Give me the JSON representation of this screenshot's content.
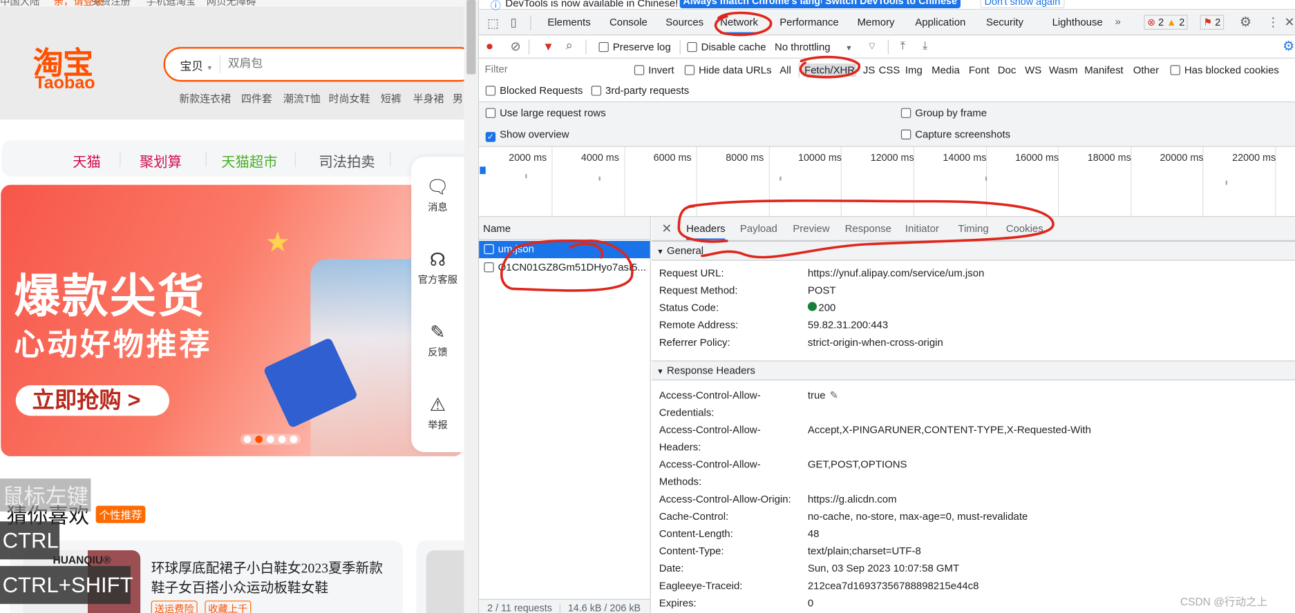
{
  "page": {
    "topbar": [
      "中国大陆",
      "亲，请登录",
      "免费注册",
      "手机逛淘宝",
      "网页无障碍"
    ],
    "logo": {
      "cn": "淘宝",
      "en": "Taobao"
    },
    "search": {
      "scope": "宝贝",
      "placeholder": "双肩包"
    },
    "hot_words": [
      "新款连衣裙",
      "四件套",
      "潮流T恤",
      "时尚女鞋",
      "短裤",
      "半身裙",
      "男"
    ],
    "nav": [
      {
        "label": "天猫",
        "color": "#d0104c"
      },
      {
        "label": "聚划算",
        "color": "#d0104c"
      },
      {
        "label": "天猫超市",
        "color": "#4caf28"
      },
      {
        "label": "司法拍卖",
        "color": "#555555"
      }
    ],
    "banner": {
      "title": "爆款尖货",
      "subtitle": "心动好物推荐",
      "cta": "立即抢购 >",
      "slides": 5,
      "active_slide": 2
    },
    "side": [
      {
        "icon": "message-icon",
        "label": "消息"
      },
      {
        "icon": "headset-icon",
        "label": "官方客服"
      },
      {
        "icon": "edit-icon",
        "label": "反馈"
      },
      {
        "icon": "warning-icon",
        "label": "举报"
      }
    ],
    "guess": {
      "title": "猜你喜欢",
      "badge": "个性推荐"
    },
    "product": {
      "brand": "HUANQIU®",
      "title_line1": "环球厚底配裙子小白鞋女2023夏季新款",
      "title_line2": "鞋子女百搭小众运动板鞋女鞋",
      "tags": [
        "送运费险",
        "收藏上千"
      ]
    },
    "key_overlays": [
      "鼠标左键",
      "CTRL",
      "CTRL+SHIFT"
    ]
  },
  "devtools": {
    "banner": {
      "text": "DevTools is now available in Chinese!",
      "btn1": "Always match Chrome's language",
      "btn2": "Switch DevTools to Chinese",
      "btn3": "Don't show again"
    },
    "tabs": [
      "Elements",
      "Console",
      "Sources",
      "Network",
      "Performance",
      "Memory",
      "Application",
      "Security",
      "Lighthouse"
    ],
    "active_tab": "Network",
    "counts": {
      "errors": "2",
      "warnings": "2",
      "issues": "2"
    },
    "toolbar": {
      "preserve_log": "Preserve log",
      "disable_cache": "Disable cache",
      "throttling": "No throttling"
    },
    "filter": {
      "placeholder": "Filter",
      "invert": "Invert",
      "hide_data_urls": "Hide data URLs",
      "types": [
        "All",
        "Fetch/XHR",
        "JS",
        "CSS",
        "Img",
        "Media",
        "Font",
        "Doc",
        "WS",
        "Wasm",
        "Manifest",
        "Other"
      ],
      "active_type": "Fetch/XHR",
      "has_blocked_cookies": "Has blocked cookies",
      "blocked_requests": "Blocked Requests",
      "third_party": "3rd-party requests"
    },
    "settings": {
      "large_rows": "Use large request rows",
      "show_overview": "Show overview",
      "show_overview_checked": true,
      "group_by_frame": "Group by frame",
      "capture_screenshots": "Capture screenshots"
    },
    "overview_ticks": [
      "2000 ms",
      "4000 ms",
      "6000 ms",
      "8000 ms",
      "10000 ms",
      "12000 ms",
      "14000 ms",
      "16000 ms",
      "18000 ms",
      "20000 ms",
      "22000 ms"
    ],
    "requests": {
      "header": "Name",
      "items": [
        "um.json",
        "O1CN01GZ8Gm51DHyo7asI5..."
      ],
      "selected": "um.json",
      "status": "2 / 11 requests",
      "size": "14.6 kB / 206 kB"
    },
    "detail_tabs": [
      "Headers",
      "Payload",
      "Preview",
      "Response",
      "Initiator",
      "Timing",
      "Cookies"
    ],
    "active_detail_tab": "Headers",
    "general": {
      "title": "General",
      "rows": [
        [
          "Request URL:",
          "https://ynuf.alipay.com/service/um.json"
        ],
        [
          "Request Method:",
          "POST"
        ],
        [
          "Status Code:",
          "200"
        ],
        [
          "Remote Address:",
          "59.82.31.200:443"
        ],
        [
          "Referrer Policy:",
          "strict-origin-when-cross-origin"
        ]
      ]
    },
    "response_headers": {
      "title": "Response Headers",
      "rows": [
        [
          "Access-Control-Allow-Credentials:",
          "true"
        ],
        [
          "Access-Control-Allow-Headers:",
          "Accept,X-PINGARUNER,CONTENT-TYPE,X-Requested-With"
        ],
        [
          "Access-Control-Allow-Methods:",
          "GET,POST,OPTIONS"
        ],
        [
          "Access-Control-Allow-Origin:",
          "https://g.alicdn.com"
        ],
        [
          "Cache-Control:",
          "no-cache, no-store, max-age=0, must-revalidate"
        ],
        [
          "Content-Length:",
          "48"
        ],
        [
          "Content-Type:",
          "text/plain;charset=UTF-8"
        ],
        [
          "Date:",
          "Sun, 03 Sep 2023 10:07:58 GMT"
        ],
        [
          "Eagleeye-Traceid:",
          "212cea7d16937356788898215e44c8"
        ],
        [
          "Expires:",
          "0"
        ]
      ]
    },
    "status_color": "#188038",
    "accent": "#1a73e8"
  },
  "watermark": "CSDN @行动之上"
}
